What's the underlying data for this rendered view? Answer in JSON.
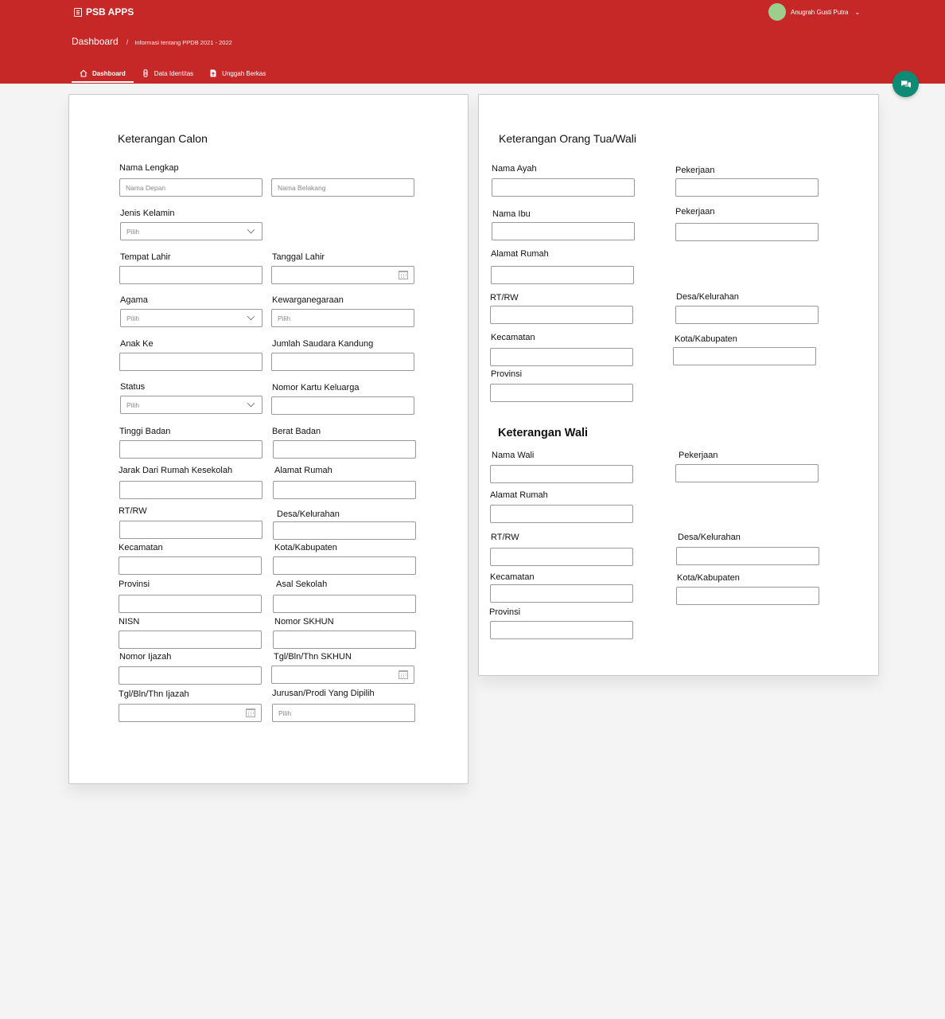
{
  "app": {
    "title": "PSB APPS"
  },
  "user": {
    "name": "Anugrah Gusti Putra"
  },
  "breadcrumb": {
    "title": "Dashboard",
    "separator": "/",
    "subtitle": "Informasi tentang PPDB 2021 - 2022"
  },
  "tabs": [
    {
      "label": "Dashboard",
      "icon": "home-icon"
    },
    {
      "label": "Data Identitas",
      "icon": "id-icon"
    },
    {
      "label": "Unggah Berkas",
      "icon": "file-upload-icon"
    }
  ],
  "colors": {
    "header": "#c62828",
    "chat_button": "#0f8a75",
    "avatar": "#9ccf8e",
    "background": "#f4f4f4"
  },
  "calon": {
    "heading": "Keterangan Calon",
    "nama_lengkap": "Nama Lengkap",
    "nama_depan_ph": "Nama Depan",
    "nama_belakang_ph": "Nama Belakang",
    "jenis_kelamin": "Jenis Kelamin",
    "jenis_kelamin_value": "Pilih",
    "tempat_lahir": "Tempat Lahir",
    "tanggal_lahir": "Tanggal Lahir",
    "agama": "Agama",
    "agama_value": "Pilih",
    "kewarganegaraan": "Kewarganegaraan",
    "kewarganegaraan_value": "Pilih",
    "anak_ke": "Anak Ke",
    "jumlah_saudara": "Jumlah Saudara Kandung",
    "status": "Status",
    "status_value": "Pilih",
    "nomor_kk": "Nomor Kartu Keluarga",
    "tinggi_badan": "Tinggi Badan",
    "berat_badan": "Berat Badan",
    "jarak": "Jarak Dari Rumah Kesekolah",
    "alamat_rumah": "Alamat Rumah",
    "rt_rw": "RT/RW",
    "desa": "Desa/Kelurahan",
    "kecamatan": "Kecamatan",
    "kota": "Kota/Kabupaten",
    "provinsi": "Provinsi",
    "asal_sekolah": "Asal Sekolah",
    "nisn": "NISN",
    "nomor_skhun": "Nomor SKHUN",
    "nomor_ijazah": "Nomor Ijazah",
    "tgl_skhun": "Tgl/Bln/Thn SKHUN",
    "tgl_ijazah": "Tgl/Bln/Thn Ijazah",
    "jurusan": "Jurusan/Prodi Yang Dipilih",
    "jurusan_value": "Pilih"
  },
  "ortu": {
    "heading": "Keterangan Orang Tua/Wali",
    "nama_ayah": "Nama Ayah",
    "pekerjaan_ayah": "Pekerjaan",
    "nama_ibu": "Nama Ibu",
    "pekerjaan_ibu": "Pekerjaan",
    "alamat_rumah": "Alamat Rumah",
    "rt_rw": "RT/RW",
    "desa": "Desa/Kelurahan",
    "kecamatan": "Kecamatan",
    "kota": "Kota/Kabupaten",
    "provinsi": "Provinsi"
  },
  "wali": {
    "heading": "Keterangan Wali",
    "nama_wali": "Nama Wali",
    "pekerjaan": "Pekerjaan",
    "alamat_rumah": "Alamat Rumah",
    "rt_rw": "RT/RW",
    "desa": "Desa/Kelurahan",
    "kecamatan": "Kecamatan",
    "kota": "Kota/Kabupaten",
    "provinsi": "Provinsi"
  }
}
